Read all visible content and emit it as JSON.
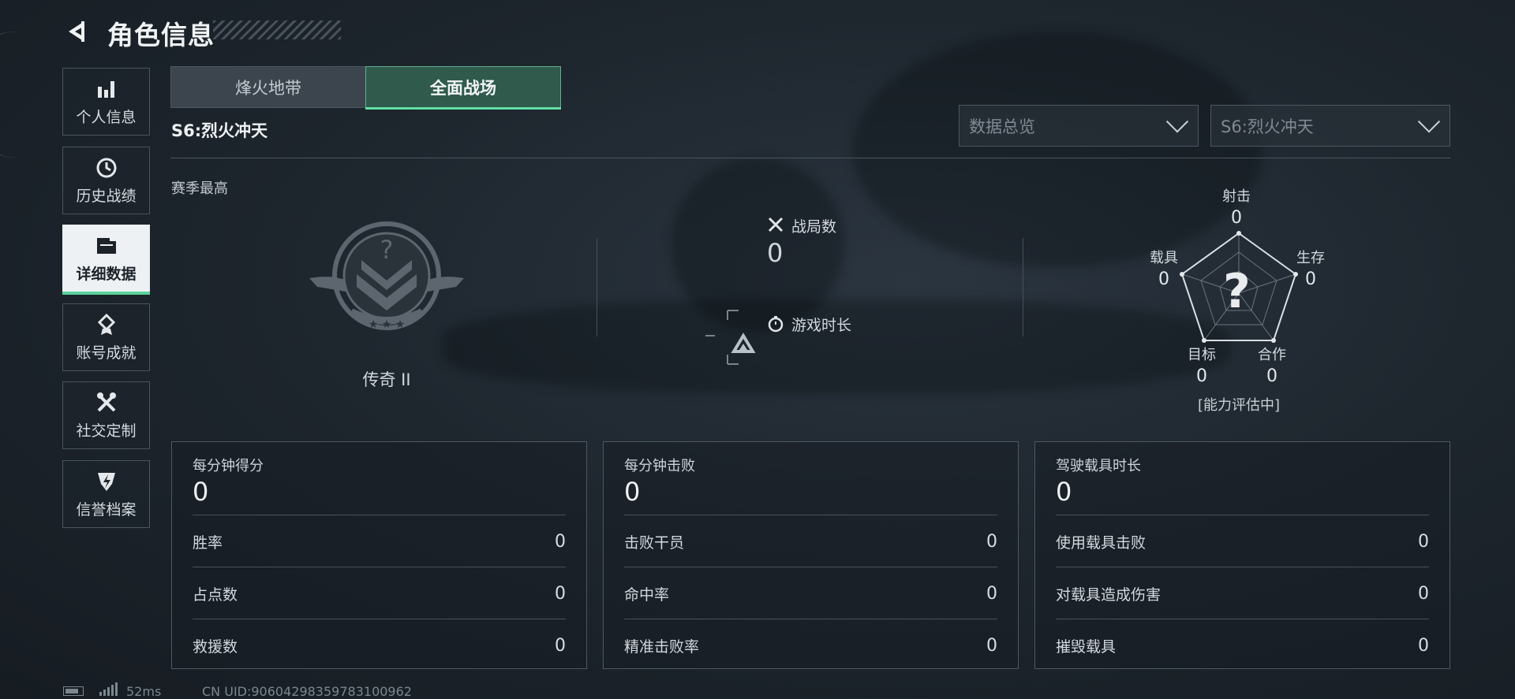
{
  "header": {
    "title": "角色信息"
  },
  "sidebar": {
    "items": [
      {
        "label": "个人信息",
        "icon": "bar-chart-icon"
      },
      {
        "label": "历史战绩",
        "icon": "history-clock-icon"
      },
      {
        "label": "详细数据",
        "icon": "folder-icon"
      },
      {
        "label": "账号成就",
        "icon": "medal-icon"
      },
      {
        "label": "社交定制",
        "icon": "tools-icon"
      },
      {
        "label": "信誉档案",
        "icon": "credit-shield-icon"
      }
    ],
    "active_index": 2
  },
  "tabs": [
    {
      "label": "烽火地带"
    },
    {
      "label": "全面战场"
    }
  ],
  "active_tab": 1,
  "season": {
    "title": "S6:烈火冲天",
    "best_label": "赛季最高",
    "rank_name": "传奇 II"
  },
  "filters": {
    "view": "数据总览",
    "season": "S6:烈火冲天"
  },
  "summary": {
    "matches_label": "战局数",
    "matches_value": "0",
    "playtime_label": "游戏时长"
  },
  "radar": {
    "axes": [
      {
        "label": "射击",
        "value": "0"
      },
      {
        "label": "生存",
        "value": "0"
      },
      {
        "label": "合作",
        "value": "0"
      },
      {
        "label": "目标",
        "value": "0"
      },
      {
        "label": "载具",
        "value": "0"
      }
    ],
    "center_symbol": "?",
    "note": "[能力评估中]"
  },
  "cards": [
    {
      "head": "每分钟得分",
      "big": "0",
      "rows": [
        {
          "label": "胜率",
          "value": "0"
        },
        {
          "label": "占点数",
          "value": "0"
        },
        {
          "label": "救援数",
          "value": "0"
        }
      ]
    },
    {
      "head": "每分钟击败",
      "big": "0",
      "rows": [
        {
          "label": "击败干员",
          "value": "0"
        },
        {
          "label": "命中率",
          "value": "0"
        },
        {
          "label": "精准击败率",
          "value": "0"
        }
      ]
    },
    {
      "head": "驾驶载具时长",
      "big": "0",
      "rows": [
        {
          "label": "使用载具击败",
          "value": "0"
        },
        {
          "label": "对载具造成伤害",
          "value": "0"
        },
        {
          "label": "摧毁载具",
          "value": "0"
        }
      ]
    }
  ],
  "footer": {
    "ping": "52ms",
    "uid": "CN UID:90604298359783100962"
  },
  "colors": {
    "accent": "#5fe0a6",
    "tab_active_bg": "#2f5a4c",
    "background": "#1e262e"
  }
}
